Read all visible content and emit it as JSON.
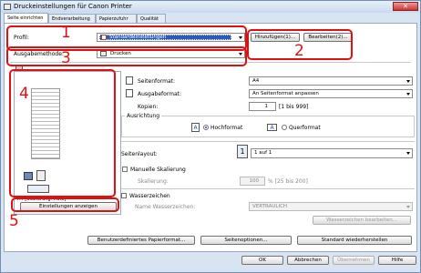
{
  "window": {
    "title": "Druckeinstellungen für Canon Printer",
    "close_glyph": "✕"
  },
  "tabs": [
    {
      "label": "Seite einrichten",
      "active": true
    },
    {
      "label": "Endverarbeitung",
      "active": false
    },
    {
      "label": "Papierzufuhr",
      "active": false
    },
    {
      "label": "Qualität",
      "active": false
    }
  ],
  "profile": {
    "label": "Profil:",
    "value": "Standardeinstellungen",
    "add_button": "Hinzufügen(1)...",
    "edit_button": "Bearbeiten(2)..."
  },
  "output_method": {
    "label": "Ausgabemethode:",
    "value": "Drucken"
  },
  "preview": {
    "caption": "A4 [Skalierung: Auto]",
    "toggle_glyph": "◩"
  },
  "view_settings_button": "Einstellungen anzeigen",
  "page_size": {
    "label": "Seitenformat:",
    "value": "A4"
  },
  "output_size": {
    "label": "Ausgabeformat:",
    "value": "An Seitenformat anpassen"
  },
  "copies": {
    "label": "Kopien:",
    "value": "1",
    "range": "[1 bis 999]"
  },
  "orientation": {
    "label": "Ausrichtung",
    "portrait": "Hochformat",
    "landscape": "Querformat",
    "selected": "portrait",
    "icon_glyph": "A"
  },
  "page_layout": {
    "label": "Seitenlayout:",
    "value": "1 auf 1",
    "icon_glyph": "1"
  },
  "manual_scaling": {
    "label": "Manuelle Skalierung",
    "scaling_label": "Skalierung:",
    "value": "100",
    "range": "% [25 bis 200]",
    "checked": false
  },
  "watermark": {
    "label": "Wasserzeichen",
    "name_label": "Name Wasserzeichen:",
    "value": "VERTRAULICH",
    "edit_button": "Wasserzeichen bearbeiten...",
    "checked": false
  },
  "bottom_buttons": {
    "custom_paper": "Benutzerdefiniertes Papierformat...",
    "page_options": "Seitenoptionen...",
    "restore_defaults": "Standard wiederherstellen"
  },
  "dialog_buttons": {
    "ok": "OK",
    "cancel": "Abbrechen",
    "apply": "Übernehmen",
    "help": "Hilfe"
  },
  "annotations": [
    "1",
    "2",
    "3",
    "4",
    "5"
  ],
  "colors": {
    "annotation_red": "#e01010",
    "profile_highlight": "#2a58c6"
  }
}
